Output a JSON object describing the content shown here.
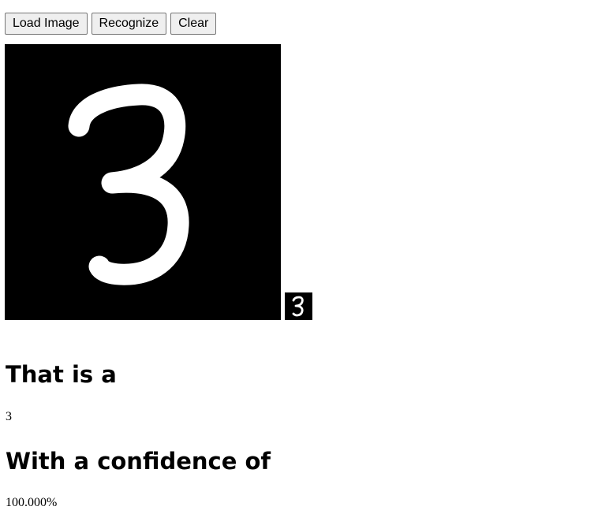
{
  "toolbar": {
    "load_label": "Load Image",
    "recognize_label": "Recognize",
    "clear_label": "Clear"
  },
  "canvas": {
    "background": "#000000",
    "stroke": "#ffffff",
    "drawn_digit_icon": "handwritten-3"
  },
  "result": {
    "heading": "That is a",
    "digit": "3",
    "confidence_heading": "With a confidence of",
    "confidence": "100.000%"
  }
}
